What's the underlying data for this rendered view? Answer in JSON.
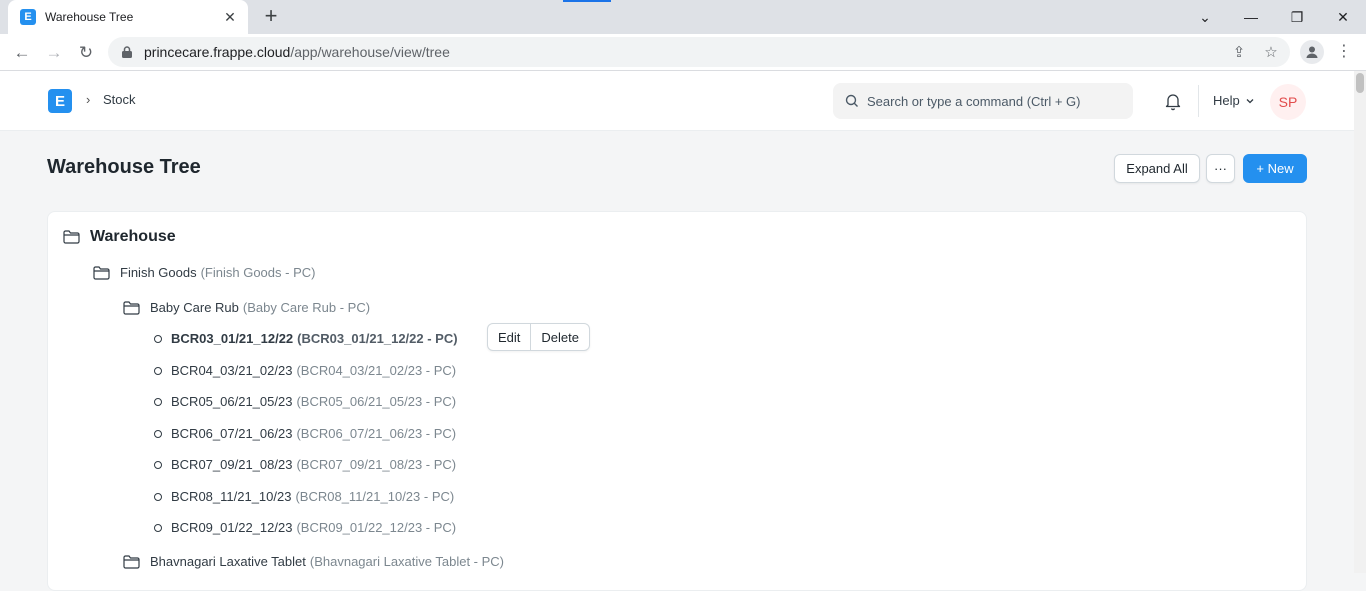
{
  "browser": {
    "tab_title": "Warehouse Tree",
    "url_host": "princecare.frappe.cloud",
    "url_path": "/app/warehouse/view/tree"
  },
  "navbar": {
    "logo_letter": "E",
    "breadcrumb": "Stock",
    "search_placeholder": "Search or type a command (Ctrl + G)",
    "help_label": "Help",
    "avatar_initials": "SP"
  },
  "page": {
    "title": "Warehouse Tree",
    "expand_all_label": "Expand All",
    "more_label": "···",
    "new_label": "+ New"
  },
  "tree": {
    "root": "Warehouse",
    "level1": {
      "label": "Finish Goods",
      "desc": "(Finish Goods - PC)"
    },
    "level2": {
      "label": "Baby Care Rub",
      "desc": "(Baby Care Rub - PC)"
    },
    "leaves": [
      {
        "label": "BCR03_01/21_12/22",
        "desc": "(BCR03_01/21_12/22 - PC)"
      },
      {
        "label": "BCR04_03/21_02/23",
        "desc": "(BCR04_03/21_02/23 - PC)"
      },
      {
        "label": "BCR05_06/21_05/23",
        "desc": "(BCR05_06/21_05/23 - PC)"
      },
      {
        "label": "BCR06_07/21_06/23",
        "desc": "(BCR06_07/21_06/23 - PC)"
      },
      {
        "label": "BCR07_09/21_08/23",
        "desc": "(BCR07_09/21_08/23 - PC)"
      },
      {
        "label": "BCR08_11/21_10/23",
        "desc": "(BCR08_11/21_10/23 - PC)"
      },
      {
        "label": "BCR09_01/22_12/23",
        "desc": "(BCR09_01/22_12/23 - PC)"
      }
    ],
    "sibling": {
      "label": "Bhavnagari Laxative Tablet",
      "desc": "(Bhavnagari Laxative Tablet - PC)"
    },
    "actions": {
      "edit": "Edit",
      "delete": "Delete"
    }
  }
}
